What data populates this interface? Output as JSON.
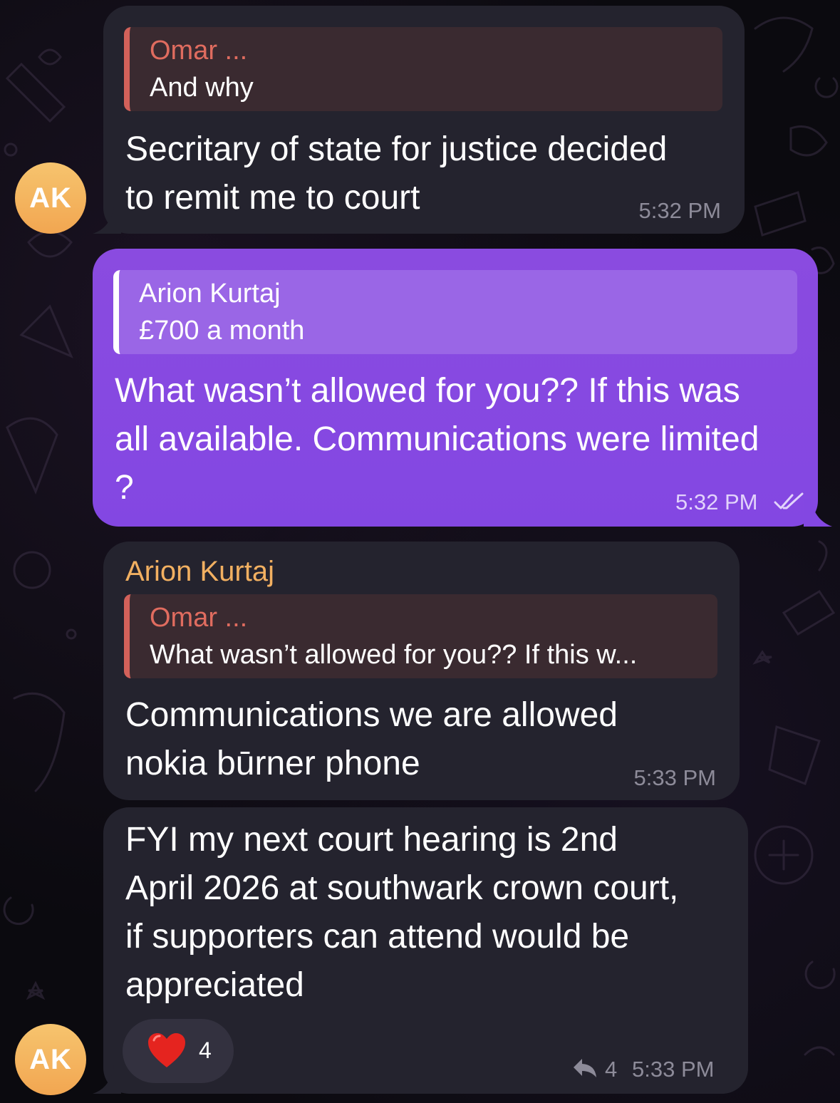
{
  "messages": [
    {
      "avatar": "AK",
      "reply": {
        "name": "Omar ...",
        "text": "And why"
      },
      "lines": [
        "Secritary of state for justice decided",
        "to remit me to court"
      ],
      "time": "5:32 PM"
    },
    {
      "reply": {
        "name": "Arion Kurtaj",
        "text": "£700 a month"
      },
      "lines": [
        "What wasn’t allowed for you?? If this was",
        "all available. Communications were limited",
        "?"
      ],
      "time": "5:32 PM",
      "status": "read"
    },
    {
      "sender": "Arion Kurtaj",
      "reply": {
        "name": "Omar ...",
        "text": "What wasn’t allowed for you?? If this w..."
      },
      "lines": [
        "Communications we are allowed",
        "nokia būrner phone"
      ],
      "time": "5:33 PM"
    },
    {
      "avatar": "AK",
      "lines": [
        "FYI my next court hearing is 2nd",
        "April 2026 at southwark crown court,",
        "if supporters can attend would be",
        "appreciated"
      ],
      "reaction": {
        "icon": "heart-icon",
        "count": "4"
      },
      "replies": "4",
      "time": "5:33 PM"
    }
  ],
  "colors": {
    "incoming_bubble": "#24232e",
    "outgoing_bubble": "#8347e2",
    "reply_accent_in": "#d2615a",
    "sender_name": "#f2b061",
    "avatar": "#f2a651"
  }
}
